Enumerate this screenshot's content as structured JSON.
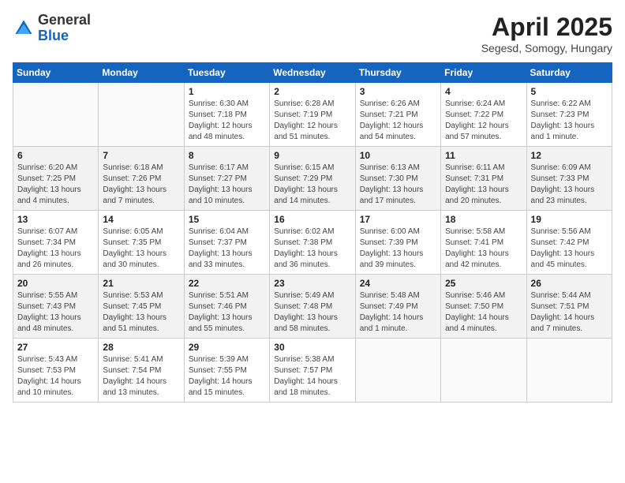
{
  "header": {
    "logo_general": "General",
    "logo_blue": "Blue",
    "month_title": "April 2025",
    "subtitle": "Segesd, Somogy, Hungary"
  },
  "weekdays": [
    "Sunday",
    "Monday",
    "Tuesday",
    "Wednesday",
    "Thursday",
    "Friday",
    "Saturday"
  ],
  "weeks": [
    [
      {
        "day": "",
        "info": ""
      },
      {
        "day": "",
        "info": ""
      },
      {
        "day": "1",
        "info": "Sunrise: 6:30 AM\nSunset: 7:18 PM\nDaylight: 12 hours\nand 48 minutes."
      },
      {
        "day": "2",
        "info": "Sunrise: 6:28 AM\nSunset: 7:19 PM\nDaylight: 12 hours\nand 51 minutes."
      },
      {
        "day": "3",
        "info": "Sunrise: 6:26 AM\nSunset: 7:21 PM\nDaylight: 12 hours\nand 54 minutes."
      },
      {
        "day": "4",
        "info": "Sunrise: 6:24 AM\nSunset: 7:22 PM\nDaylight: 12 hours\nand 57 minutes."
      },
      {
        "day": "5",
        "info": "Sunrise: 6:22 AM\nSunset: 7:23 PM\nDaylight: 13 hours\nand 1 minute."
      }
    ],
    [
      {
        "day": "6",
        "info": "Sunrise: 6:20 AM\nSunset: 7:25 PM\nDaylight: 13 hours\nand 4 minutes."
      },
      {
        "day": "7",
        "info": "Sunrise: 6:18 AM\nSunset: 7:26 PM\nDaylight: 13 hours\nand 7 minutes."
      },
      {
        "day": "8",
        "info": "Sunrise: 6:17 AM\nSunset: 7:27 PM\nDaylight: 13 hours\nand 10 minutes."
      },
      {
        "day": "9",
        "info": "Sunrise: 6:15 AM\nSunset: 7:29 PM\nDaylight: 13 hours\nand 14 minutes."
      },
      {
        "day": "10",
        "info": "Sunrise: 6:13 AM\nSunset: 7:30 PM\nDaylight: 13 hours\nand 17 minutes."
      },
      {
        "day": "11",
        "info": "Sunrise: 6:11 AM\nSunset: 7:31 PM\nDaylight: 13 hours\nand 20 minutes."
      },
      {
        "day": "12",
        "info": "Sunrise: 6:09 AM\nSunset: 7:33 PM\nDaylight: 13 hours\nand 23 minutes."
      }
    ],
    [
      {
        "day": "13",
        "info": "Sunrise: 6:07 AM\nSunset: 7:34 PM\nDaylight: 13 hours\nand 26 minutes."
      },
      {
        "day": "14",
        "info": "Sunrise: 6:05 AM\nSunset: 7:35 PM\nDaylight: 13 hours\nand 30 minutes."
      },
      {
        "day": "15",
        "info": "Sunrise: 6:04 AM\nSunset: 7:37 PM\nDaylight: 13 hours\nand 33 minutes."
      },
      {
        "day": "16",
        "info": "Sunrise: 6:02 AM\nSunset: 7:38 PM\nDaylight: 13 hours\nand 36 minutes."
      },
      {
        "day": "17",
        "info": "Sunrise: 6:00 AM\nSunset: 7:39 PM\nDaylight: 13 hours\nand 39 minutes."
      },
      {
        "day": "18",
        "info": "Sunrise: 5:58 AM\nSunset: 7:41 PM\nDaylight: 13 hours\nand 42 minutes."
      },
      {
        "day": "19",
        "info": "Sunrise: 5:56 AM\nSunset: 7:42 PM\nDaylight: 13 hours\nand 45 minutes."
      }
    ],
    [
      {
        "day": "20",
        "info": "Sunrise: 5:55 AM\nSunset: 7:43 PM\nDaylight: 13 hours\nand 48 minutes."
      },
      {
        "day": "21",
        "info": "Sunrise: 5:53 AM\nSunset: 7:45 PM\nDaylight: 13 hours\nand 51 minutes."
      },
      {
        "day": "22",
        "info": "Sunrise: 5:51 AM\nSunset: 7:46 PM\nDaylight: 13 hours\nand 55 minutes."
      },
      {
        "day": "23",
        "info": "Sunrise: 5:49 AM\nSunset: 7:48 PM\nDaylight: 13 hours\nand 58 minutes."
      },
      {
        "day": "24",
        "info": "Sunrise: 5:48 AM\nSunset: 7:49 PM\nDaylight: 14 hours\nand 1 minute."
      },
      {
        "day": "25",
        "info": "Sunrise: 5:46 AM\nSunset: 7:50 PM\nDaylight: 14 hours\nand 4 minutes."
      },
      {
        "day": "26",
        "info": "Sunrise: 5:44 AM\nSunset: 7:51 PM\nDaylight: 14 hours\nand 7 minutes."
      }
    ],
    [
      {
        "day": "27",
        "info": "Sunrise: 5:43 AM\nSunset: 7:53 PM\nDaylight: 14 hours\nand 10 minutes."
      },
      {
        "day": "28",
        "info": "Sunrise: 5:41 AM\nSunset: 7:54 PM\nDaylight: 14 hours\nand 13 minutes."
      },
      {
        "day": "29",
        "info": "Sunrise: 5:39 AM\nSunset: 7:55 PM\nDaylight: 14 hours\nand 15 minutes."
      },
      {
        "day": "30",
        "info": "Sunrise: 5:38 AM\nSunset: 7:57 PM\nDaylight: 14 hours\nand 18 minutes."
      },
      {
        "day": "",
        "info": ""
      },
      {
        "day": "",
        "info": ""
      },
      {
        "day": "",
        "info": ""
      }
    ]
  ]
}
